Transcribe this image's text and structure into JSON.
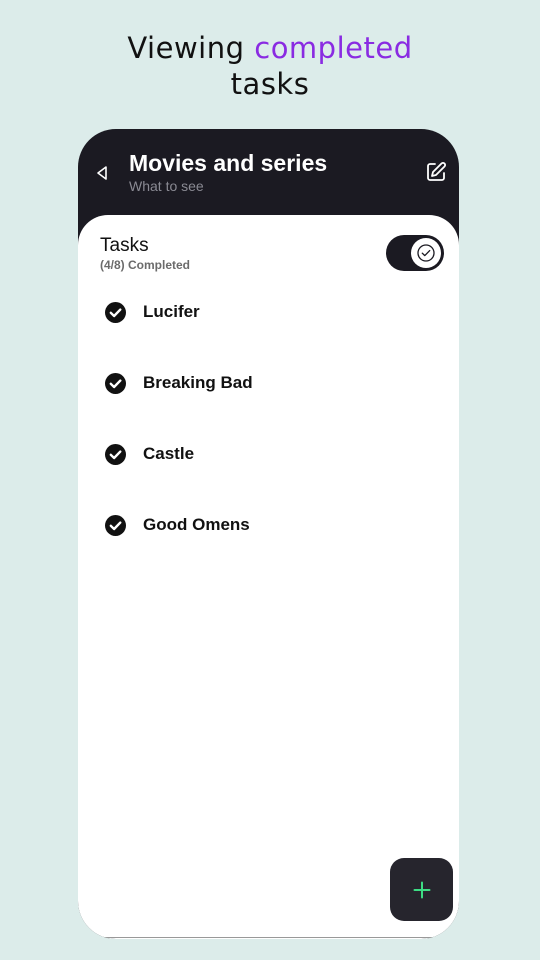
{
  "headline": {
    "part1": "Viewing ",
    "accent": "completed",
    "part2": "tasks",
    "accent_color": "#8a2be2"
  },
  "app_bar": {
    "back_icon": "back-triangle-icon",
    "title": "Movies and series",
    "subtitle": "What to see",
    "edit_icon": "edit-pencil-icon"
  },
  "tasks_section": {
    "title": "Tasks",
    "count_label": "(4/8) Completed",
    "toggle_on": true,
    "toggle_icon": "check-circle-icon"
  },
  "tasks": [
    {
      "label": "Lucifer",
      "completed": true
    },
    {
      "label": "Breaking Bad",
      "completed": true
    },
    {
      "label": "Castle",
      "completed": true
    },
    {
      "label": "Good Omens",
      "completed": true
    }
  ],
  "fab": {
    "icon": "plus-icon",
    "icon_color": "#3ddc84"
  },
  "colors": {
    "background": "#dcecea",
    "dark": "#1b1a22"
  }
}
